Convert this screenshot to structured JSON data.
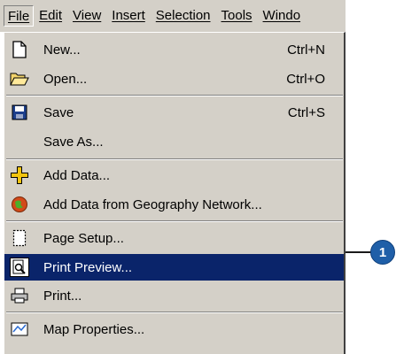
{
  "menubar": {
    "items": [
      "File",
      "Edit",
      "View",
      "Insert",
      "Selection",
      "Tools",
      "Windo"
    ]
  },
  "file_menu": {
    "items": [
      {
        "label": "New...",
        "shortcut": "Ctrl+N",
        "icon": "new-document-icon"
      },
      {
        "label": "Open...",
        "shortcut": "Ctrl+O",
        "icon": "open-folder-icon"
      },
      {
        "label": "Save",
        "shortcut": "Ctrl+S",
        "icon": "save-disk-icon"
      },
      {
        "label": "Save As...",
        "shortcut": "",
        "icon": ""
      },
      {
        "label": "Add Data...",
        "shortcut": "",
        "icon": "add-data-icon"
      },
      {
        "label": "Add Data from Geography Network...",
        "shortcut": "",
        "icon": "globe-icon"
      },
      {
        "label": "Page Setup...",
        "shortcut": "",
        "icon": "page-setup-icon"
      },
      {
        "label": "Print Preview...",
        "shortcut": "",
        "icon": "print-preview-icon",
        "highlighted": true
      },
      {
        "label": "Print...",
        "shortcut": "",
        "icon": "printer-icon"
      },
      {
        "label": "Map Properties...",
        "shortcut": "",
        "icon": "map-properties-icon"
      }
    ]
  },
  "callout": {
    "number": "1"
  },
  "colors": {
    "highlight": "#0a246a",
    "menu_bg": "#d4d0c8",
    "callout": "#1f5fa8"
  }
}
